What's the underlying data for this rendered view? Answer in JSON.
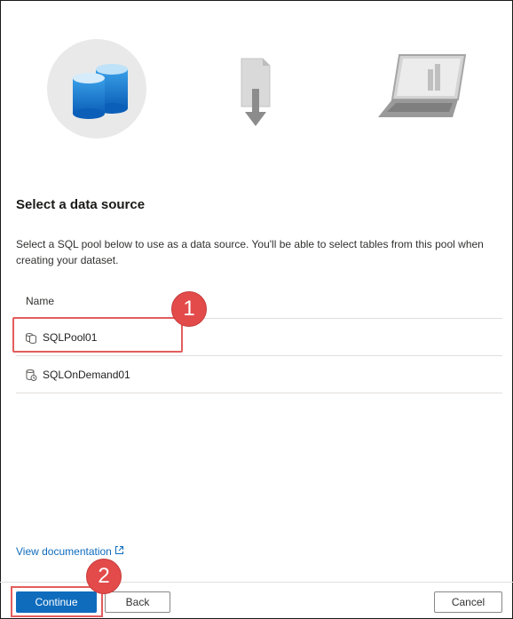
{
  "steps": [
    {
      "name": "data-source",
      "state": "active"
    },
    {
      "name": "file-download",
      "state": "pending"
    },
    {
      "name": "laptop-report",
      "state": "pending"
    }
  ],
  "heading": "Select a data source",
  "description": "Select a SQL pool below to use as a data source. You'll be able to select tables from this pool when creating your dataset.",
  "table": {
    "column_header": "Name",
    "rows": [
      {
        "label": "SQLPool01",
        "icon": "dedicated-sql-pool-icon"
      },
      {
        "label": "SQLOnDemand01",
        "icon": "serverless-sql-pool-icon"
      }
    ]
  },
  "annotations": {
    "badge1": "1",
    "badge2": "2"
  },
  "link": {
    "text": "View documentation",
    "icon": "external-link-icon"
  },
  "footer": {
    "continue": "Continue",
    "back": "Back",
    "cancel": "Cancel"
  },
  "colors": {
    "accent": "#0f6cbd",
    "annotation": "#e34b4b"
  }
}
